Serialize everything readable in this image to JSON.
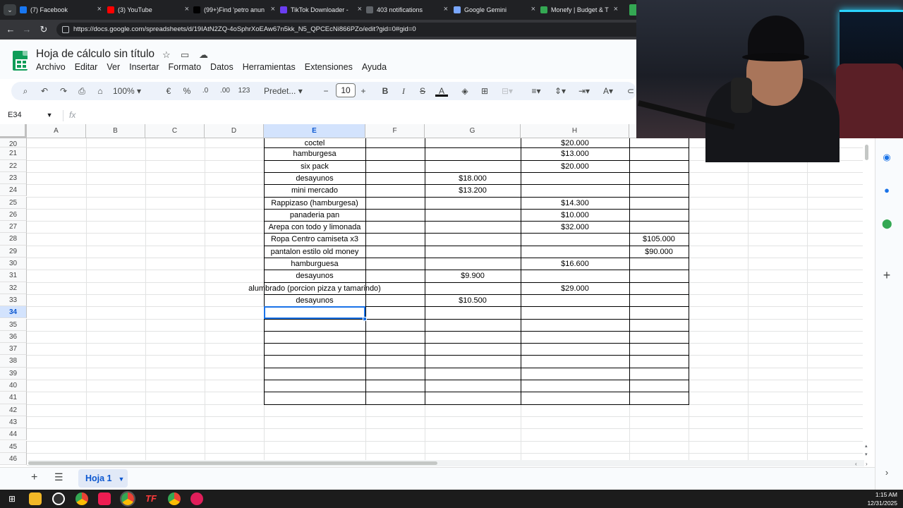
{
  "browser": {
    "tabs": [
      {
        "title": "(7) Facebook",
        "color": "#1877f2"
      },
      {
        "title": "(3) YouTube",
        "color": "#ff0000"
      },
      {
        "title": "(99+)Find 'petro anun",
        "color": "#010101"
      },
      {
        "title": "TikTok Downloader -",
        "color": "#6a3df0"
      },
      {
        "title": "403 notifications",
        "color": "#5f6368"
      },
      {
        "title": "Google Gemini",
        "color": "#7aa7ff"
      },
      {
        "title": "Monefy | Budget & T",
        "color": "#34a853"
      }
    ],
    "url": "https://docs.google.com/spreadsheets/d/19IAtN2ZQ-4oSphrXoEAw67n5kk_N5_QPCEcNi866PZo/edit?gid=0#gid=0"
  },
  "doc": {
    "title": "Hoja de cálculo sin título",
    "menu": [
      "Archivo",
      "Editar",
      "Ver",
      "Insertar",
      "Formato",
      "Datos",
      "Herramientas",
      "Extensiones",
      "Ayuda"
    ]
  },
  "toolbar": {
    "zoom": "100%",
    "currency": "€",
    "percent": "%",
    "dec_less": ".0",
    "dec_more": ".00",
    "number_format": "123",
    "font": "Predet...",
    "font_size": "10",
    "bold": "B",
    "italic": "I",
    "strike": "S",
    "text_color": "A"
  },
  "formula_bar": {
    "name_box": "E34",
    "fx": "fx"
  },
  "grid": {
    "columns": [
      "A",
      "B",
      "C",
      "D",
      "E",
      "F",
      "G",
      "H"
    ],
    "rows": [
      "20",
      "21",
      "22",
      "23",
      "24",
      "25",
      "26",
      "27",
      "28",
      "29",
      "30",
      "31",
      "32",
      "33",
      "34",
      "35",
      "36",
      "37",
      "38",
      "39",
      "40",
      "41",
      "42",
      "43",
      "44",
      "45",
      "46"
    ],
    "selected_row": "34",
    "selected_col": "E",
    "cells": [
      {
        "row": "20",
        "col": "E",
        "text": "coctel"
      },
      {
        "row": "20",
        "col": "H",
        "text": "$20.000"
      },
      {
        "row": "21",
        "col": "E",
        "text": "hamburgesa"
      },
      {
        "row": "21",
        "col": "H",
        "text": "$13.000"
      },
      {
        "row": "22",
        "col": "E",
        "text": "six pack"
      },
      {
        "row": "22",
        "col": "H",
        "text": "$20.000"
      },
      {
        "row": "23",
        "col": "E",
        "text": "desayunos"
      },
      {
        "row": "23",
        "col": "G",
        "text": "$18.000"
      },
      {
        "row": "24",
        "col": "E",
        "text": "mini mercado"
      },
      {
        "row": "24",
        "col": "G",
        "text": "$13.200"
      },
      {
        "row": "25",
        "col": "E",
        "text": "Rappizaso (hamburgesa)"
      },
      {
        "row": "25",
        "col": "H",
        "text": "$14.300"
      },
      {
        "row": "26",
        "col": "E",
        "text": "panaderia pan"
      },
      {
        "row": "26",
        "col": "H",
        "text": "$10.000"
      },
      {
        "row": "27",
        "col": "E",
        "text": "Arepa con todo y limonada"
      },
      {
        "row": "27",
        "col": "H",
        "text": "$32.000"
      },
      {
        "row": "28",
        "col": "E",
        "text": "Ropa Centro camiseta x3"
      },
      {
        "row": "28",
        "col": "I",
        "text": "$105.000"
      },
      {
        "row": "29",
        "col": "E",
        "text": "pantalon estilo old money"
      },
      {
        "row": "29",
        "col": "I",
        "text": "$90.000"
      },
      {
        "row": "30",
        "col": "E",
        "text": "hamburguesa"
      },
      {
        "row": "30",
        "col": "H",
        "text": "$16.600"
      },
      {
        "row": "31",
        "col": "E",
        "text": "desayunos"
      },
      {
        "row": "31",
        "col": "G",
        "text": "$9.900"
      },
      {
        "row": "32",
        "col": "E",
        "text": "alumbrado (porcion pizza y tamarindo)"
      },
      {
        "row": "32",
        "col": "H",
        "text": "$29.000"
      },
      {
        "row": "33",
        "col": "E",
        "text": "desayunos"
      },
      {
        "row": "33",
        "col": "G",
        "text": "$10.500"
      }
    ]
  },
  "sheets": {
    "active": "Hoja 1"
  },
  "taskbar": {
    "time": "1:15 AM",
    "date": "12/31/2025"
  }
}
